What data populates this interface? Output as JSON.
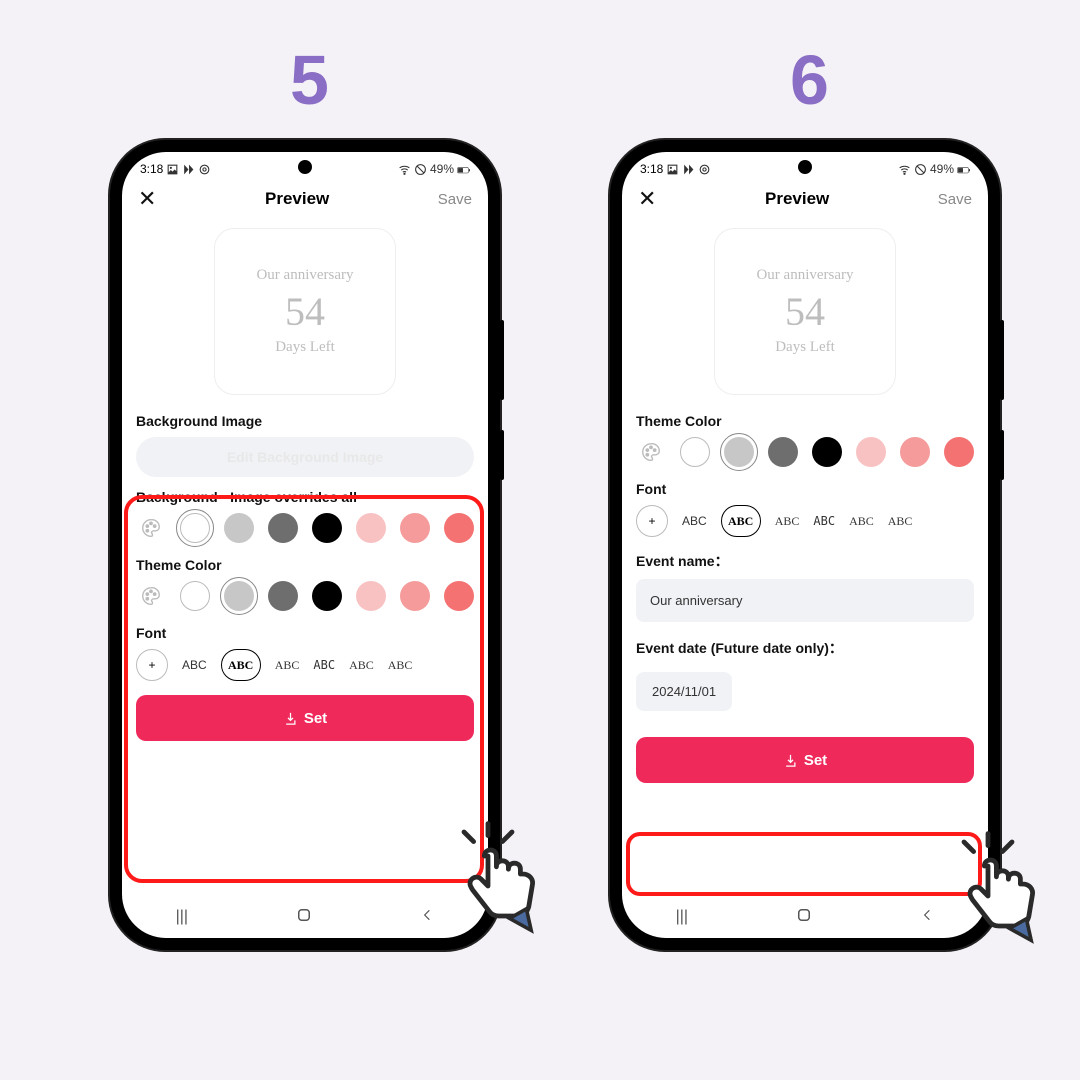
{
  "steps": {
    "s5": "5",
    "s6": "6"
  },
  "status": {
    "time": "3:18",
    "battery": "49%"
  },
  "header": {
    "title": "Preview",
    "save": "Save"
  },
  "widget": {
    "line1": "Our anniversary",
    "count": "54",
    "line2": "Days Left"
  },
  "labels": {
    "bgImage": "Background Image",
    "editBg": "Edit Background Image",
    "bgOverride": "Background - Image overrides all",
    "themeColor": "Theme Color",
    "font": "Font",
    "eventName": "Event name：",
    "eventDate": "Event date (Future date only)：",
    "set": "Set"
  },
  "fonts": [
    "ABC",
    "ABC",
    "ABC",
    "ABC",
    "ABC",
    "ABC"
  ],
  "swatches": {
    "bg": [
      "#ffffff",
      "#c7c7c7",
      "#6e6e6e",
      "#000000",
      "#f9c2c2",
      "#f59b9b",
      "#f47272"
    ],
    "theme": [
      "#ffffff",
      "#c7c7c7",
      "#6e6e6e",
      "#000000",
      "#f9c2c2",
      "#f59b9b",
      "#f47272"
    ]
  },
  "values": {
    "eventName": "Our anniversary",
    "eventDate": "2024/11/01"
  }
}
